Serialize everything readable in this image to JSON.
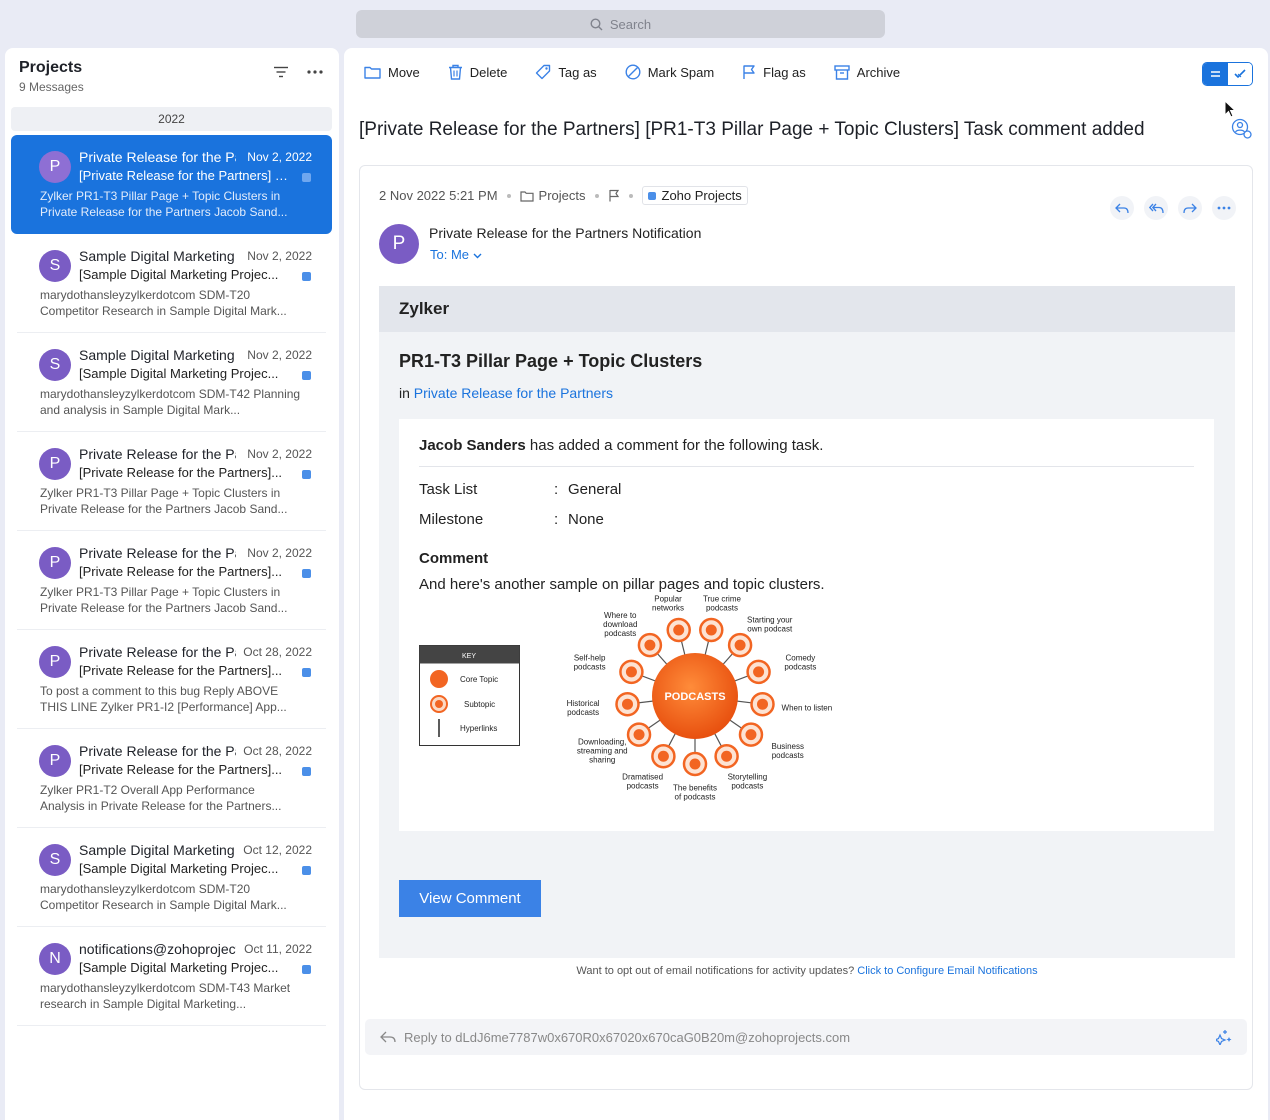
{
  "search": {
    "placeholder": "Search"
  },
  "folder": {
    "title": "Projects",
    "count": "9 Messages",
    "year_group": "2022"
  },
  "messages": [
    {
      "avatar": "P",
      "sender": "Private Release for the Partners",
      "date": "Nov 2, 2022",
      "subject": "[Private Release for the Partners] [PR1-T3 Pillar Page + Topic Clusters] Task comment added",
      "preview": "Zylker PR1-T3 Pillar Page + Topic Clusters in Private Release for the Partners Jacob Sand...",
      "selected": true
    },
    {
      "avatar": "S",
      "sender": "Sample Digital Marketing",
      "date": "Nov 2, 2022",
      "subject": "[Sample Digital Marketing Projec...",
      "preview": "marydothansleyzylkerdotcom SDM-T20 Competitor Research in Sample Digital Mark..."
    },
    {
      "avatar": "S",
      "sender": "Sample Digital Marketing",
      "date": "Nov 2, 2022",
      "subject": "[Sample Digital Marketing Projec...",
      "preview": "marydothansleyzylkerdotcom SDM-T42 Planning and analysis in Sample Digital Mark..."
    },
    {
      "avatar": "P",
      "sender": "Private Release for the Partners",
      "date": "Nov 2, 2022",
      "subject": "[Private Release for the Partners]...",
      "preview": "Zylker PR1-T3 Pillar Page + Topic Clusters in Private Release for the Partners Jacob Sand..."
    },
    {
      "avatar": "P",
      "sender": "Private Release for the Partners",
      "date": "Nov 2, 2022",
      "subject": "[Private Release for the Partners]...",
      "preview": "Zylker PR1-T3 Pillar Page + Topic Clusters in Private Release for the Partners Jacob Sand..."
    },
    {
      "avatar": "P",
      "sender": "Private Release for the Partners",
      "date": "Oct 28, 2022",
      "subject": "[Private Release for the Partners]...",
      "preview": " To post a comment to this bug Reply ABOVE THIS LINE  Zylker PR1-I2 [Performance] App..."
    },
    {
      "avatar": "P",
      "sender": "Private Release for the Partners",
      "date": "Oct 28, 2022",
      "subject": "[Private Release for the Partners]...",
      "preview": "Zylker PR1-T2 Overall App Performance Analysis in Private Release for the Partners..."
    },
    {
      "avatar": "S",
      "sender": "Sample Digital Marketing",
      "date": "Oct 12, 2022",
      "subject": "[Sample Digital Marketing Projec...",
      "preview": "marydothansleyzylkerdotcom SDM-T20 Competitor Research in Sample Digital Mark..."
    },
    {
      "avatar": "N",
      "sender": "notifications@zohoprojects.com",
      "date": "Oct 11, 2022",
      "subject": "[Sample Digital Marketing Projec...",
      "preview": "marydothansleyzylkerdotcom SDM-T43 Market research in Sample Digital Marketing..."
    }
  ],
  "toolbar": {
    "move": "Move",
    "delete": "Delete",
    "tag": "Tag as",
    "spam": "Mark Spam",
    "flag": "Flag as",
    "archive": "Archive"
  },
  "mail": {
    "title": "[Private Release for the Partners] [PR1-T3 Pillar Page + Topic Clusters] Task comment added",
    "datetime": "2 Nov 2022 5:21 PM",
    "folder": "Projects",
    "tag": "Zoho Projects",
    "sender_avatar": "P",
    "sender": "Private Release for the Partners Notification",
    "to": "To: Me",
    "brand": "Zylker",
    "task_title": "PR1-T3 Pillar Page + Topic Clusters",
    "in_label": "in",
    "project_link": "Private Release for the Partners",
    "commenter": "Jacob Sanders",
    "comment_intro": " has added a comment for the following task.",
    "tasklist_key": "Task List",
    "tasklist_val": "General",
    "milestone_key": "Milestone",
    "milestone_val": "None",
    "colon": ":",
    "comment_heading": "Comment",
    "comment_text": "And here's another sample on pillar pages and topic clusters.",
    "view_button": "View Comment",
    "optout_text": "Want to opt out of email notifications for activity updates? ",
    "optout_link": "Click to Configure Email Notifications",
    "reply_placeholder": "Reply to dLdJ6me7787w0x670R0x67020x670caG0B20m@zohoprojects.com"
  },
  "diagram": {
    "key_title": "KEY",
    "key_items": [
      "Core Topic",
      "Subtopic",
      "Hyperlinks"
    ],
    "core": "PODCASTS",
    "subtopics": [
      "Popular networks",
      "True crime podcasts",
      "Starting your own podcast",
      "Comedy podcasts",
      "When to listen",
      "Business podcasts",
      "Storytelling podcasts",
      "The benefits of podcasts",
      "Dramatised podcasts",
      "Downloading, streaming and sharing",
      "Historical podcasts",
      "Self-help podcasts",
      "Where to download podcasts"
    ]
  },
  "colors": {
    "accent": "#1a73dd",
    "avatar": "#7a5cc4",
    "tag": "#4b8fe8",
    "core_orange": "#f26522"
  }
}
